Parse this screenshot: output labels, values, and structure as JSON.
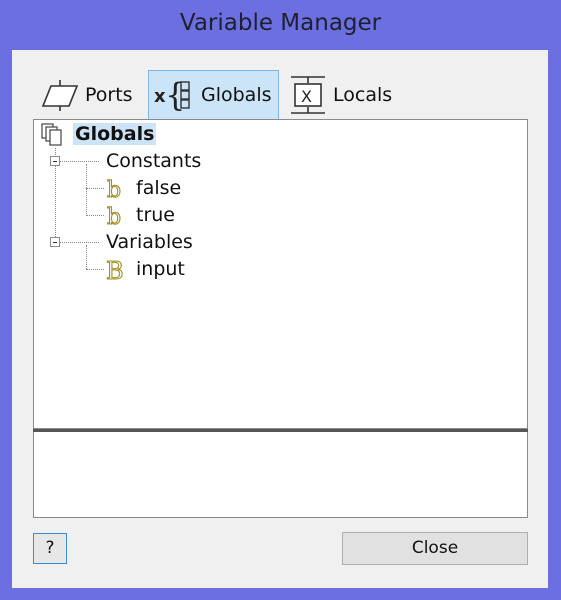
{
  "window": {
    "title": "Variable Manager"
  },
  "tabs": [
    {
      "label": "Ports",
      "icon": "ports-icon"
    },
    {
      "label": "Globals",
      "icon": "globals-icon",
      "selected": true
    },
    {
      "label": "Locals",
      "icon": "locals-icon"
    }
  ],
  "tree": {
    "root": "Globals",
    "groups": [
      {
        "label": "Constants",
        "items": [
          "false",
          "true"
        ]
      },
      {
        "label": "Variables",
        "items": [
          "input"
        ]
      }
    ]
  },
  "buttons": {
    "help": "?",
    "close": "Close"
  },
  "colors": {
    "frame": "#6b6fe0",
    "selection": "#cde3f6",
    "boolean_icon": "#c8b43a"
  }
}
